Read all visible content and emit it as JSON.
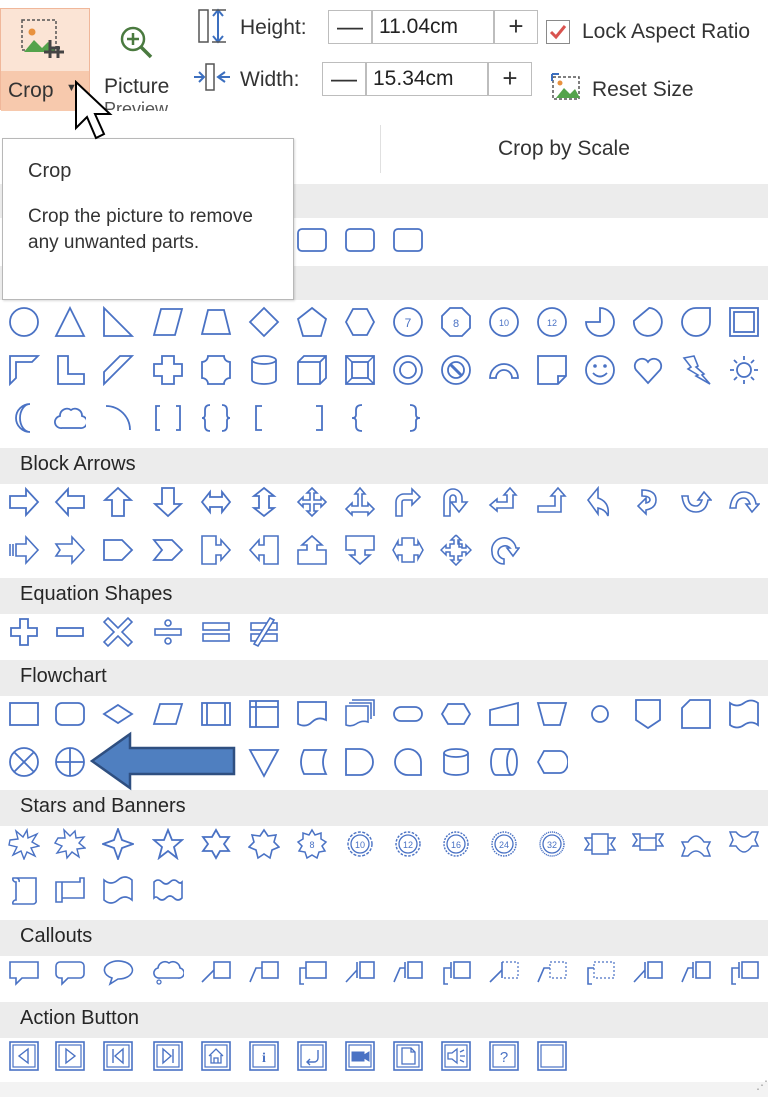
{
  "ribbon": {
    "crop_label": "Crop",
    "picture_label": "Picture",
    "picture_label_line2": "Preview",
    "height_label": "Height:",
    "height_value": "11.04cm",
    "width_label": "Width:",
    "width_value": "15.34cm",
    "minus": "—",
    "plus": "+",
    "lock_aspect_label": "Lock Aspect Ratio",
    "lock_aspect_checked": true,
    "reset_size_label": "Reset Size"
  },
  "tabs": {
    "crop_by_scale": "Crop by Scale"
  },
  "tooltip": {
    "title": "Crop",
    "body": "Crop the picture to remove any unwanted parts."
  },
  "sections": {
    "block_arrows": "Block Arrows",
    "equation_shapes": "Equation Shapes",
    "flowchart": "Flowchart",
    "stars_banners": "Stars and Banners",
    "callouts": "Callouts",
    "action_button": "Action Button"
  },
  "colors": {
    "shape_stroke": "#4a72c4",
    "arrow_fill": "#4f7fc0",
    "arrow_stroke": "#2f4f80",
    "crop_active_bg": "#fbe4d5",
    "checkbox_mark": "#d9534f"
  },
  "equation_glyphs": [
    "+",
    "−",
    "×",
    "÷",
    "=",
    "≠"
  ],
  "star_numbers": [
    "8",
    "10",
    "12",
    "16",
    "24",
    "32"
  ],
  "action_glyphs": [
    "◁",
    "▷",
    "⏮",
    "⏭",
    "⌂",
    "i",
    "↩",
    "🎥",
    "▢",
    "◁)",
    "?",
    ""
  ]
}
